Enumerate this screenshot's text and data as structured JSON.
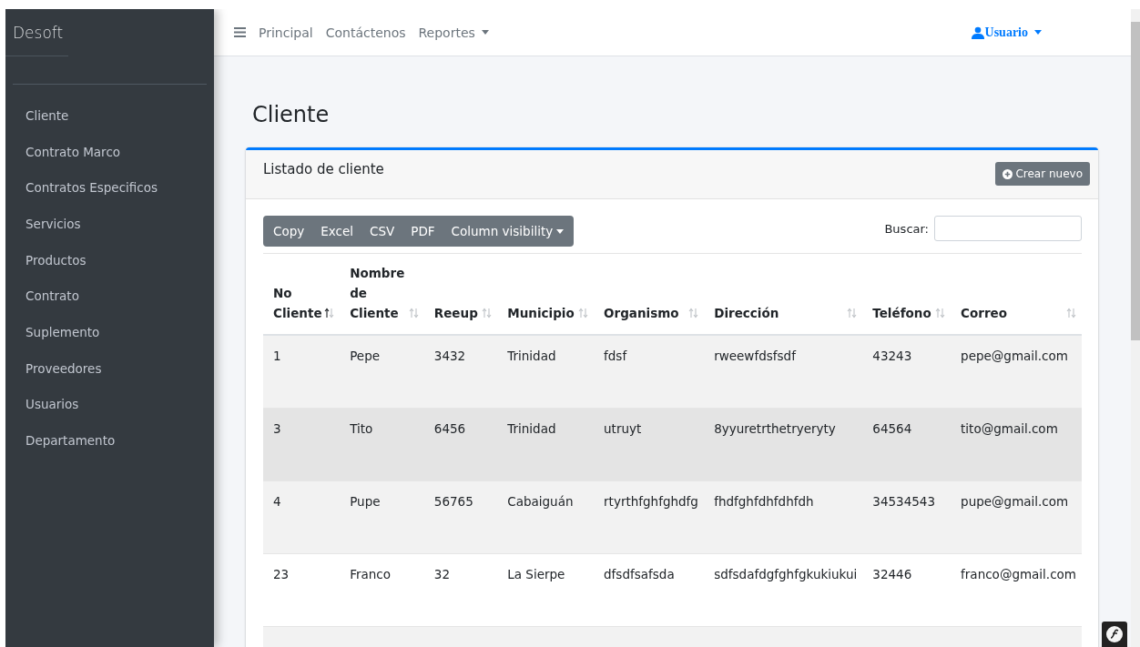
{
  "brand": "Desoft",
  "sidebar": {
    "items": [
      {
        "label": "Cliente",
        "selected": false
      },
      {
        "label": "Contrato Marco",
        "selected": false
      },
      {
        "label": "Contratos Especificos",
        "selected": false
      },
      {
        "label": "Servicios",
        "selected": false
      },
      {
        "label": "Productos",
        "selected": false
      },
      {
        "label": "Contrato",
        "selected": false
      },
      {
        "label": "Suplemento",
        "selected": false
      },
      {
        "label": "Proveedores",
        "selected": false
      },
      {
        "label": "Usuarios",
        "selected": false
      },
      {
        "label": "Departamento",
        "selected": false
      }
    ]
  },
  "navbar": {
    "links": [
      {
        "label": "Principal",
        "dropdown": false
      },
      {
        "label": "Contáctenos",
        "dropdown": false
      },
      {
        "label": "Reportes",
        "dropdown": true
      }
    ],
    "user": "Usuario"
  },
  "page_title": "Cliente",
  "card": {
    "title": "Listado de cliente",
    "create_button": "Crear nuevo"
  },
  "export_buttons": [
    {
      "label": "Copy",
      "dropdown": false
    },
    {
      "label": "Excel",
      "dropdown": false
    },
    {
      "label": "CSV",
      "dropdown": false
    },
    {
      "label": "PDF",
      "dropdown": false
    },
    {
      "label": "Column visibility",
      "dropdown": true
    }
  ],
  "search": {
    "label": "Buscar:"
  },
  "table": {
    "columns": [
      {
        "label": "No Cliente",
        "sorted": true
      },
      {
        "label": "Nombre de Cliente",
        "sorted": false
      },
      {
        "label": "Reeup",
        "sorted": false
      },
      {
        "label": "Municipio",
        "sorted": false
      },
      {
        "label": "Organismo",
        "sorted": false
      },
      {
        "label": "Dirección",
        "sorted": false
      },
      {
        "label": "Teléfono",
        "sorted": false
      },
      {
        "label": "Correo",
        "sorted": false
      }
    ],
    "rows": [
      {
        "cells": [
          "1",
          "Pepe",
          "3432",
          "Trinidad",
          "fdsf",
          "rweewfdsfsdf",
          "43243",
          "pepe@gmail.com"
        ],
        "hovered": false
      },
      {
        "cells": [
          "3",
          "Tito",
          "6456",
          "Trinidad",
          "utruyt",
          "8yyuretrthetryeryty",
          "64564",
          "tito@gmail.com"
        ],
        "hovered": true
      },
      {
        "cells": [
          "4",
          "Pupe",
          "56765",
          "Cabaiguán",
          "rtyrthfghfghdfg",
          "fhdfghfdhfdhfdh",
          "34534543",
          "pupe@gmail.com"
        ],
        "hovered": false
      },
      {
        "cells": [
          "23",
          "Franco",
          "32",
          "La Sierpe",
          "dfsdfsafsda",
          "sdfsdafdgfghfgkukiukui",
          "32446",
          "franco@gmail.com"
        ],
        "hovered": false
      }
    ]
  }
}
